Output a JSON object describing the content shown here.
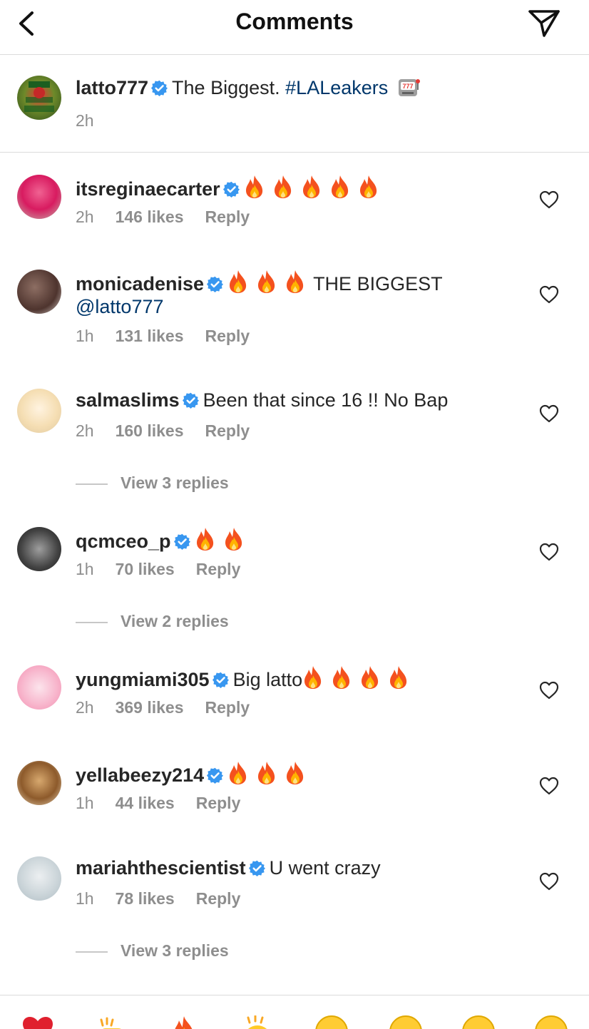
{
  "header": {
    "title": "Comments",
    "back_icon": "chevron-left-icon",
    "share_icon": "paper-plane-icon"
  },
  "caption": {
    "username": "latto777",
    "text": "The Biggest.",
    "hashtag": "#LALeakers",
    "emoji": "slot-machine-emoji",
    "time": "2h"
  },
  "comments": [
    {
      "username": "itsreginaecarter",
      "text": "",
      "fires": 5,
      "time": "2h",
      "likes": "146 likes",
      "reply": "Reply"
    },
    {
      "username": "monicadenise",
      "text": "THE BIGGEST",
      "mention": "@latto777",
      "fires": 3,
      "time": "1h",
      "likes": "131 likes",
      "reply": "Reply"
    },
    {
      "username": "salmaslims",
      "text": "Been that since 16 !! No Bap",
      "fires": 0,
      "time": "2h",
      "likes": "160 likes",
      "reply": "Reply",
      "view_replies": "View 3 replies"
    },
    {
      "username": "qcmceo_p",
      "text": "",
      "fires": 2,
      "time": "1h",
      "likes": "70 likes",
      "reply": "Reply",
      "view_replies": "View 2 replies"
    },
    {
      "username": "yungmiami305",
      "text": "Big latto",
      "fires": 4,
      "time": "2h",
      "likes": "369 likes",
      "reply": "Reply"
    },
    {
      "username": "yellabeezy214",
      "text": "",
      "fires": 3,
      "time": "1h",
      "likes": "44 likes",
      "reply": "Reply"
    },
    {
      "username": "mariahthescientist",
      "text": "U went crazy",
      "fires": 0,
      "time": "1h",
      "likes": "78 likes",
      "reply": "Reply",
      "view_replies": "View 3 replies"
    }
  ],
  "reaction_bar": [
    "red-heart-emoji",
    "raising-hands-emoji",
    "fire-emoji",
    "clapping-hands-emoji",
    "crying-laughing-emoji",
    "heart-eyes-emoji",
    "astonished-emoji",
    "laughing-emoji"
  ],
  "colors": {
    "text": "#262626",
    "secondary": "#8e8e8e",
    "link": "#00376b",
    "verified": "#3897f0",
    "divider": "#dbdbdb"
  }
}
